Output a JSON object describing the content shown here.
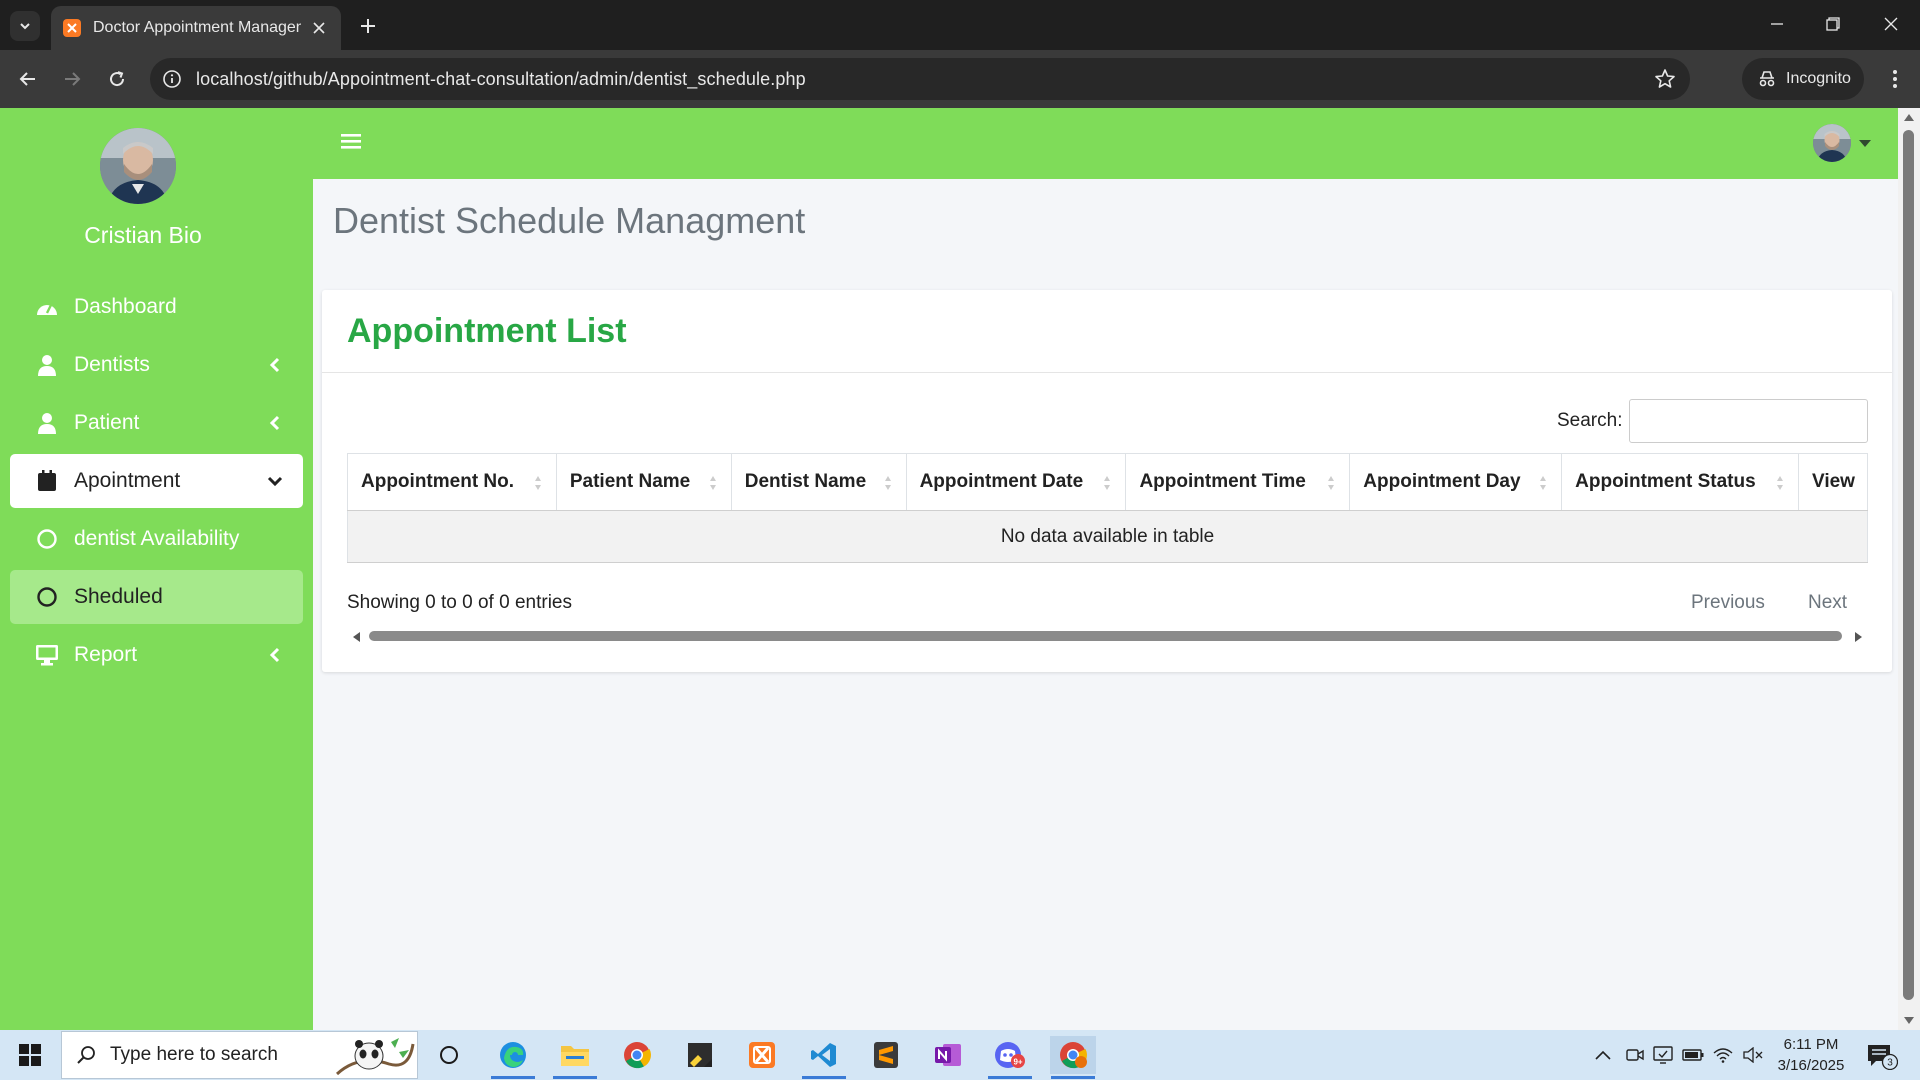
{
  "browser": {
    "tab_title": "Doctor Appointment Managem",
    "url": "localhost/github/Appointment-chat-consultation/admin/dentist_schedule.php",
    "incognito_label": "Incognito"
  },
  "sidebar": {
    "user_name": "Cristian Bio",
    "items": [
      {
        "label": "Dashboard",
        "icon": "dashboard-icon"
      },
      {
        "label": "Dentists",
        "icon": "user-icon"
      },
      {
        "label": "Patient",
        "icon": "user-icon"
      },
      {
        "label": "Apointment",
        "icon": "calendar-icon"
      },
      {
        "label": "dentist Availability",
        "icon": "circle-icon"
      },
      {
        "label": "Sheduled",
        "icon": "circle-icon"
      },
      {
        "label": "Report",
        "icon": "desktop-icon"
      }
    ]
  },
  "main": {
    "page_title": "Dentist Schedule Managment",
    "card_title": "Appointment List",
    "search_label": "Search:",
    "search_value": "",
    "columns": [
      "Appointment No.",
      "Patient Name",
      "Dentist Name",
      "Appointment Date",
      "Appointment Time",
      "Appointment Day",
      "Appointment Status",
      "View"
    ],
    "empty_message": "No data available in table",
    "info": "Showing 0 to 0 of 0 entries",
    "previous_label": "Previous",
    "next_label": "Next"
  },
  "taskbar": {
    "search_placeholder": "Type here to search",
    "time": "6:11 PM",
    "date": "3/16/2025",
    "notification_count": "3",
    "discord_badge": "9+"
  },
  "colors": {
    "sidebar_green": "#7fdc59",
    "title_green": "#28a745",
    "selected_item": "#a6e98b"
  }
}
